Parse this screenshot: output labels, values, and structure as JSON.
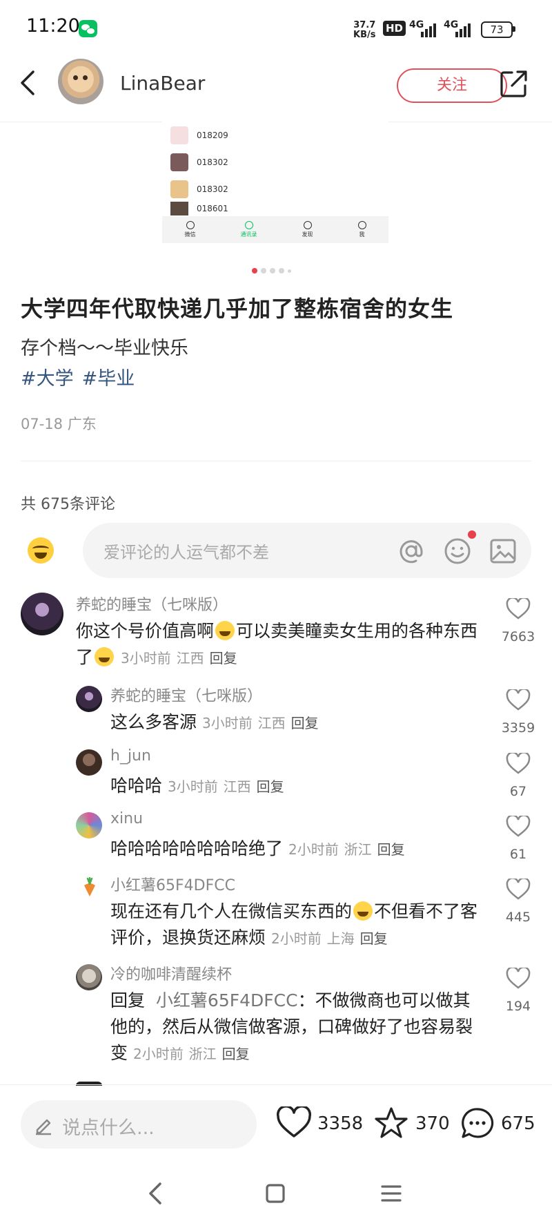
{
  "status_bar": {
    "time": "11:20",
    "net_speed_value": "37.7",
    "net_speed_unit": "KB/s",
    "hd": "HD",
    "signal1": "4G",
    "signal2": "4G",
    "battery": "73"
  },
  "header": {
    "username": "LinaBear",
    "follow_label": "关注"
  },
  "image_preview": {
    "rows": [
      "018209",
      "018302",
      "018302",
      "018601"
    ],
    "tabs": [
      "微信",
      "通讯录",
      "发现",
      "我"
    ],
    "active_tab": 1,
    "page_dots": 5,
    "active_dot": 0
  },
  "post": {
    "title": "大学四年代取快递几乎加了整栋宿舍的女生",
    "description": "存个档～～毕业快乐",
    "tags": [
      "#大学",
      "#毕业"
    ],
    "meta": "07-18 广东"
  },
  "comments_header": {
    "count_label": "共 675条评论",
    "input_placeholder": "爱评论的人运气都不差"
  },
  "comments": [
    {
      "name": "养蛇的睡宝（七咪版）",
      "text_part1": "你这个号价值高啊",
      "text_part2": "可以卖美瞳卖女生用的各种东西了",
      "time": "3小时前",
      "location": "江西",
      "reply": "回复",
      "likes": "7663"
    },
    {
      "name": "养蛇的睡宝（七咪版）",
      "text": "这么多客源",
      "time": "3小时前",
      "location": "江西",
      "reply": "回复",
      "likes": "3359"
    },
    {
      "name": "h_jun",
      "text": "哈哈哈",
      "time": "3小时前",
      "location": "江西",
      "reply": "回复",
      "likes": "67"
    },
    {
      "name": "xinu",
      "text": "哈哈哈哈哈哈哈哈绝了",
      "time": "2小时前",
      "location": "浙江",
      "reply": "回复",
      "likes": "61"
    },
    {
      "name": "小红薯65F4DFCC",
      "text_part1": "现在还有几个人在微信买东西的",
      "text_part2": "不但看不了客评价，退换货还麻烦",
      "time": "2小时前",
      "location": "上海",
      "reply": "回复",
      "likes": "445"
    },
    {
      "name": "冷的咖啡清醒续杯",
      "reply_prefix": "回复",
      "mention": "小红薯65F4DFCC",
      "text": "：不做微商也可以做其他的，然后从微信做客源，口碑做好了也容易裂变",
      "time": "2小时前",
      "location": "浙江",
      "reply": "回复",
      "likes": "194"
    }
  ],
  "bottom_bar": {
    "say_placeholder": "说点什么...",
    "likes": "3358",
    "stars": "370",
    "comments": "675"
  },
  "colors": {
    "accent_red": "#e0505a",
    "tag_blue": "#34557f",
    "wechat_green": "#07c160"
  }
}
